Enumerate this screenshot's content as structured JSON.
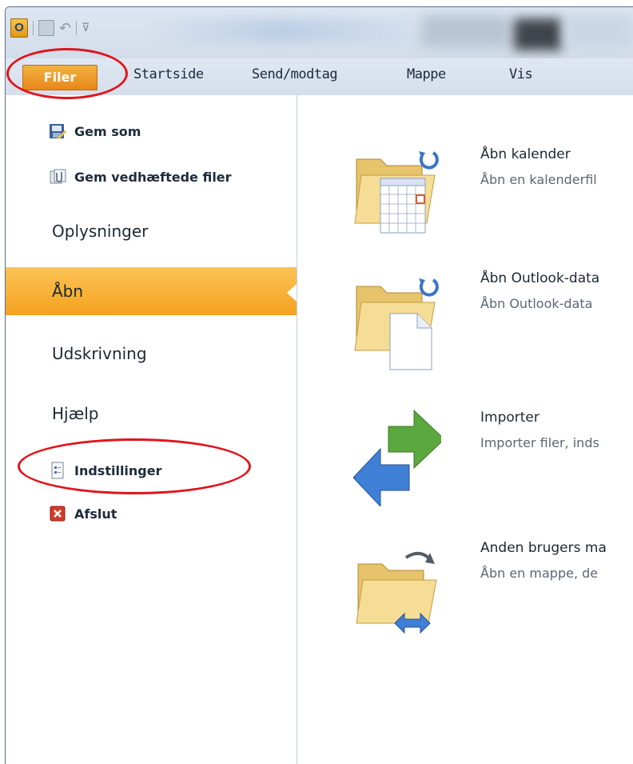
{
  "qat": {
    "app_icon_letter": "O",
    "icons": [
      "outlook-app-icon",
      "save-icon",
      "undo-icon",
      "customize-qat-icon"
    ]
  },
  "ribbon": {
    "file_tab": "Filer",
    "tabs": [
      "Startside",
      "Send/modtag",
      "Mappe",
      "Vis"
    ]
  },
  "nav": {
    "save_as": "Gem som",
    "save_attachments": "Gem vedhæftede filer",
    "info": "Oplysninger",
    "open": "Åbn",
    "print": "Udskrivning",
    "help": "Hjælp",
    "options": "Indstillinger",
    "exit": "Afslut"
  },
  "main": {
    "actions": [
      {
        "title": "Åbn kalender",
        "desc": "Åbn en kalenderfil"
      },
      {
        "title": "Åbn Outlook-data",
        "desc": "Åbn Outlook-data"
      },
      {
        "title": "Importer",
        "desc": "Importer filer, inds"
      },
      {
        "title": "Anden brugers ma",
        "desc": "Åbn en mappe, de"
      }
    ]
  },
  "colors": {
    "accent_orange": "#f4a21f",
    "annotation_red": "#e0151c",
    "window_blue": "#d5dfeb"
  }
}
